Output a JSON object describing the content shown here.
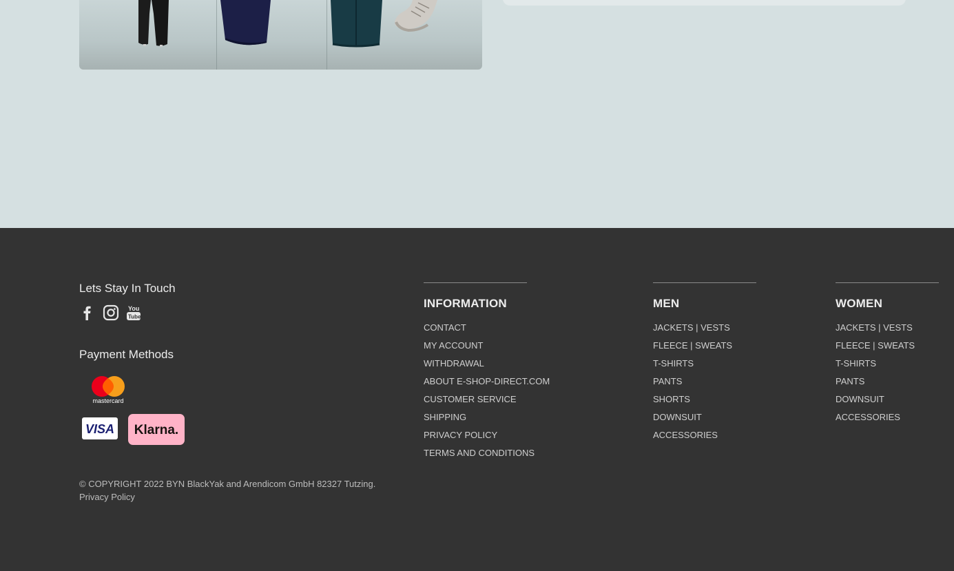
{
  "products": {
    "items": [
      "pants",
      "vest",
      "jacket",
      "sneaker"
    ]
  },
  "footer": {
    "touch_title": "Lets Stay In Touch",
    "social": [
      "facebook-icon",
      "instagram-icon",
      "youtube-icon"
    ],
    "payment_title": "Payment Methods",
    "payment": {
      "mastercard": "mastercard",
      "visa": "VISA",
      "klarna": "Klarna."
    },
    "youtube_you": "You",
    "youtube_tube": "Tube",
    "copyright": "© COPYRIGHT 2022 BYN BlackYak and Arendicom GmbH 82327 Tutzing.",
    "privacy": "Privacy Policy",
    "columns": [
      {
        "title": "INFORMATION",
        "items": [
          "CONTACT",
          "MY ACCOUNT",
          "WITHDRAWAL",
          "ABOUT E-SHOP-DIRECT.COM",
          "CUSTOMER SERVICE",
          "SHIPPING",
          "PRIVACY POLICY",
          "TERMS AND CONDITIONS"
        ]
      },
      {
        "title": "MEN",
        "items": [
          "JACKETS | VESTS",
          "FLEECE | SWEATS",
          "T-SHIRTS",
          "PANTS",
          "SHORTS",
          "DOWNSUIT",
          "ACCESSORIES"
        ]
      },
      {
        "title": "WOMEN",
        "items": [
          "JACKETS | VESTS",
          "FLEECE | SWEATS",
          "T-SHIRTS",
          "PANTS",
          "DOWNSUIT",
          "ACCESSORIES"
        ]
      }
    ]
  },
  "colors": {
    "page_bg": "#d5e0e1",
    "footer_bg": "#333333",
    "mastercard_red": "#eb001b",
    "mastercard_orange": "#f79e1b",
    "visa_blue": "#1a1f71",
    "klarna_pink": "#ffb3c7"
  }
}
